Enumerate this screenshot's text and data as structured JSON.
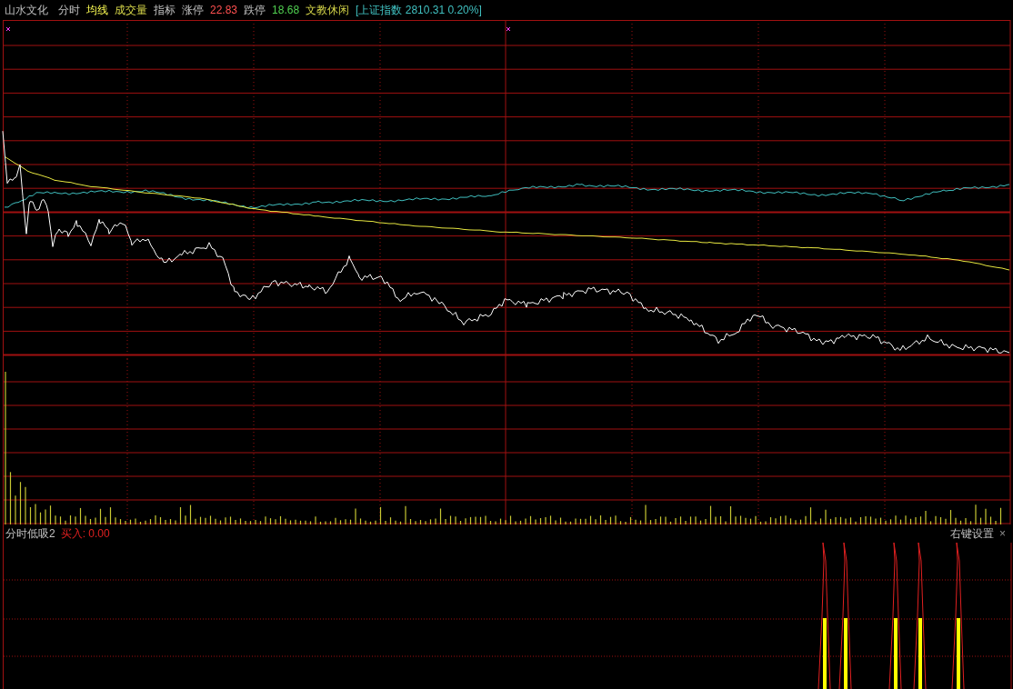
{
  "header": {
    "stock_name": "山水文化",
    "tabs": [
      {
        "label": "分时",
        "kind": "plain"
      },
      {
        "label": "均线",
        "kind": "average"
      },
      {
        "label": "成交量",
        "kind": "volume"
      },
      {
        "label": "指标",
        "kind": "plain"
      }
    ],
    "limit_up": {
      "label": "涨停",
      "value": "22.83"
    },
    "limit_down": {
      "label": "跌停",
      "value": "18.68"
    },
    "sector": "文教休闲",
    "index": "[上证指数 2810.31 0.20%]"
  },
  "indicator": {
    "name": "分时低吸2",
    "signal": "买入: 0.00",
    "settings": "右键设置",
    "close": "×"
  }
}
